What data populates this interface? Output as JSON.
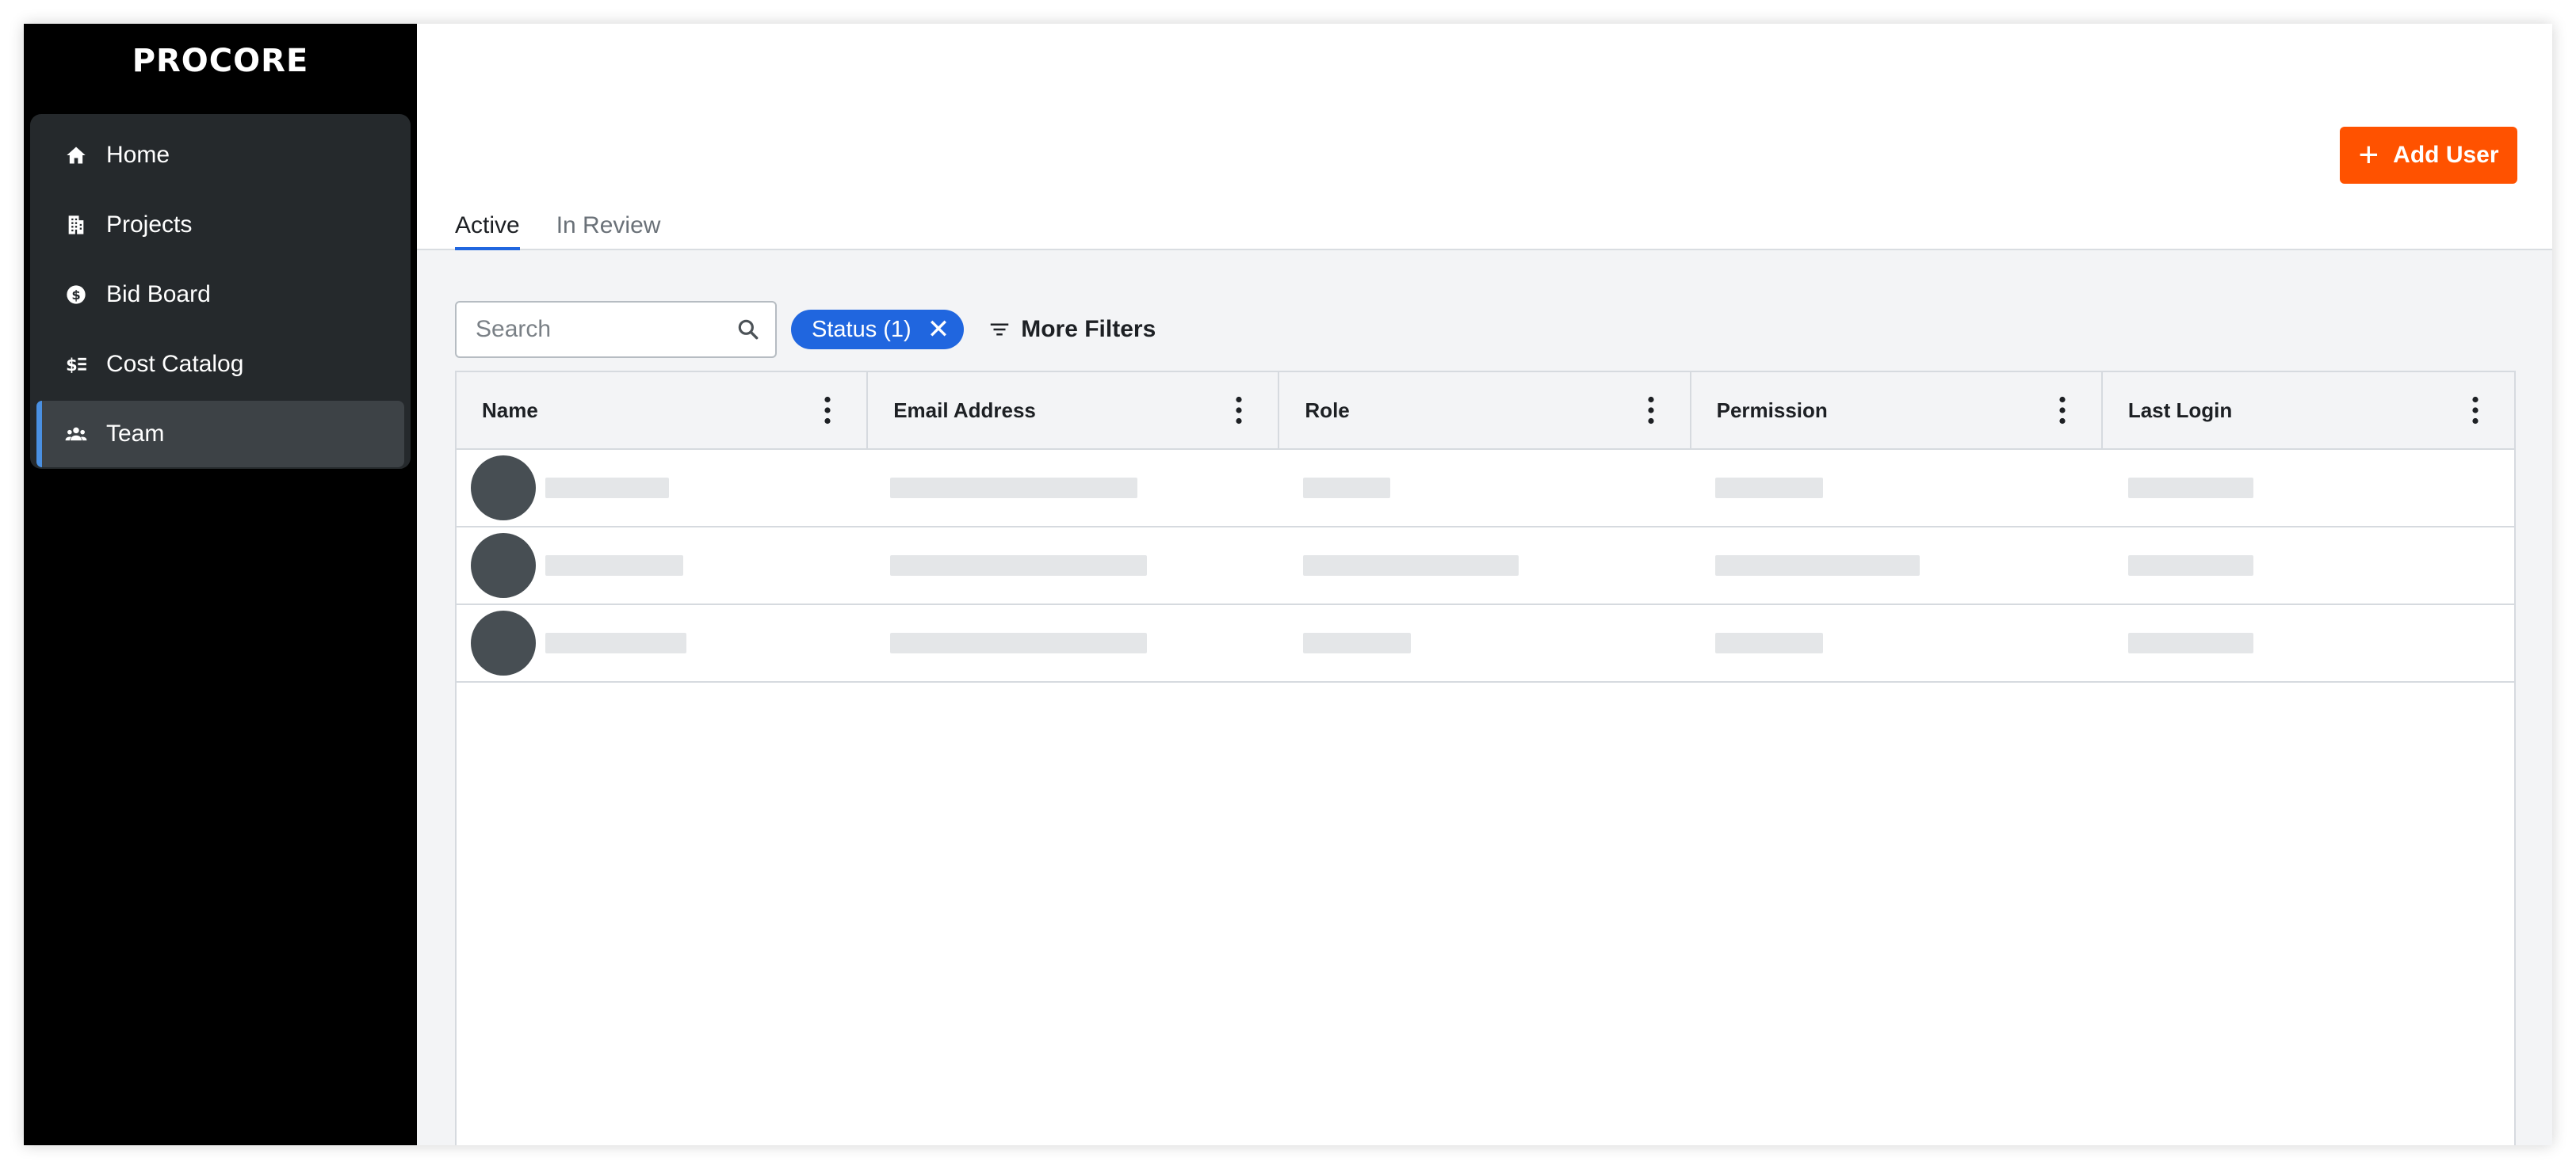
{
  "app": {
    "logo_text": "PROCORE"
  },
  "sidebar": {
    "items": [
      {
        "label": "Home",
        "icon": "home-icon"
      },
      {
        "label": "Projects",
        "icon": "building-icon"
      },
      {
        "label": "Bid Board",
        "icon": "dollar-circle-icon"
      },
      {
        "label": "Cost Catalog",
        "icon": "cost-list-icon"
      },
      {
        "label": "Team",
        "icon": "people-icon",
        "active": true
      }
    ]
  },
  "header": {
    "add_user_label": "Add User"
  },
  "tabs": [
    {
      "label": "Active",
      "active": true
    },
    {
      "label": "In Review",
      "active": false
    }
  ],
  "filters": {
    "search_placeholder": "Search",
    "status_chip": "Status (1)",
    "more_filters_label": "More Filters"
  },
  "table": {
    "columns": [
      "Name",
      "Email Address",
      "Role",
      "Permission",
      "Last Login"
    ],
    "rows": [
      {
        "loading": true
      },
      {
        "loading": true
      },
      {
        "loading": true
      }
    ]
  },
  "colors": {
    "accent": "#ff5200",
    "primary_blue": "#2066df",
    "sidebar_bg": "#000000",
    "nav_panel_bg": "#25292c",
    "skeleton": "#e4e6e8"
  }
}
